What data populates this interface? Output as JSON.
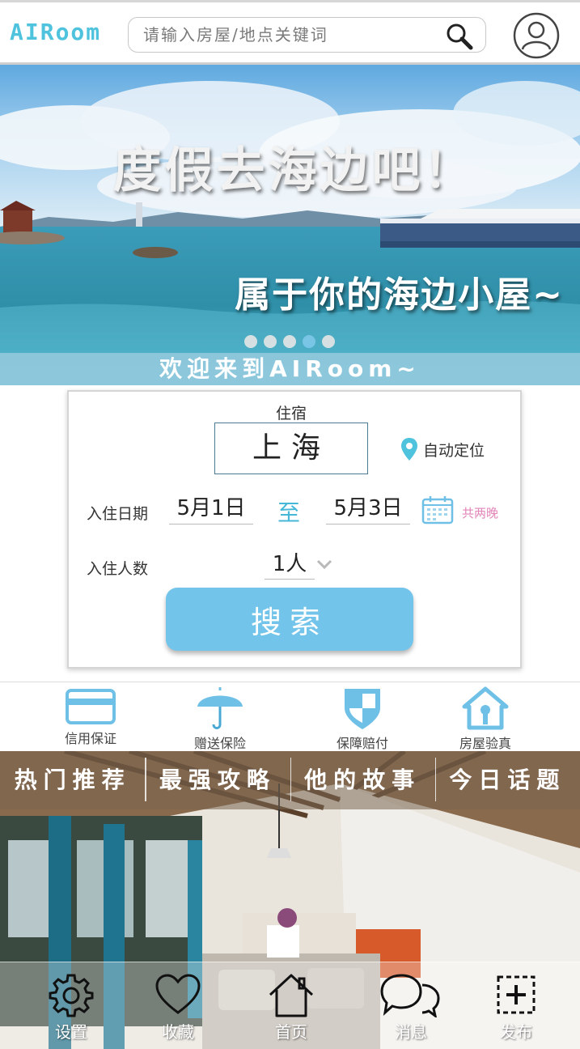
{
  "header": {
    "logo": "AIRoom",
    "search_placeholder": "请输入房屋/地点关键词"
  },
  "banner": {
    "title": "度假去海边吧！",
    "subtitle": "属于你的海边小屋~",
    "slide_count": 5,
    "active_slide": 4,
    "welcome": "欢迎来到AIRoom~"
  },
  "booking": {
    "stay_label": "住宿",
    "city": "上海",
    "auto_locate": "自动定位",
    "checkin_label": "入住日期",
    "checkin_date": "5月1日",
    "to_label": "至",
    "checkout_date": "5月3日",
    "nights": "共两晚",
    "guests_label": "入住人数",
    "guests": "1人",
    "search_button": "搜索"
  },
  "features": [
    {
      "label": "信用保证",
      "icon": "credit-card-icon"
    },
    {
      "label": "赠送保险",
      "icon": "umbrella-icon"
    },
    {
      "label": "保障赔付",
      "icon": "shield-icon"
    },
    {
      "label": "房屋验真",
      "icon": "house-icon"
    }
  ],
  "tabs": [
    "热门推荐",
    "最强攻略",
    "他的故事",
    "今日话题"
  ],
  "bottom_nav": [
    {
      "label": "设置",
      "icon": "gear-icon"
    },
    {
      "label": "收藏",
      "icon": "heart-icon"
    },
    {
      "label": "首页",
      "icon": "home-icon"
    },
    {
      "label": "消息",
      "icon": "chat-icon"
    },
    {
      "label": "发布",
      "icon": "add-icon"
    }
  ],
  "colors": {
    "accent": "#4fc3dd",
    "button": "#73c4ea",
    "nights": "#e384b8"
  }
}
